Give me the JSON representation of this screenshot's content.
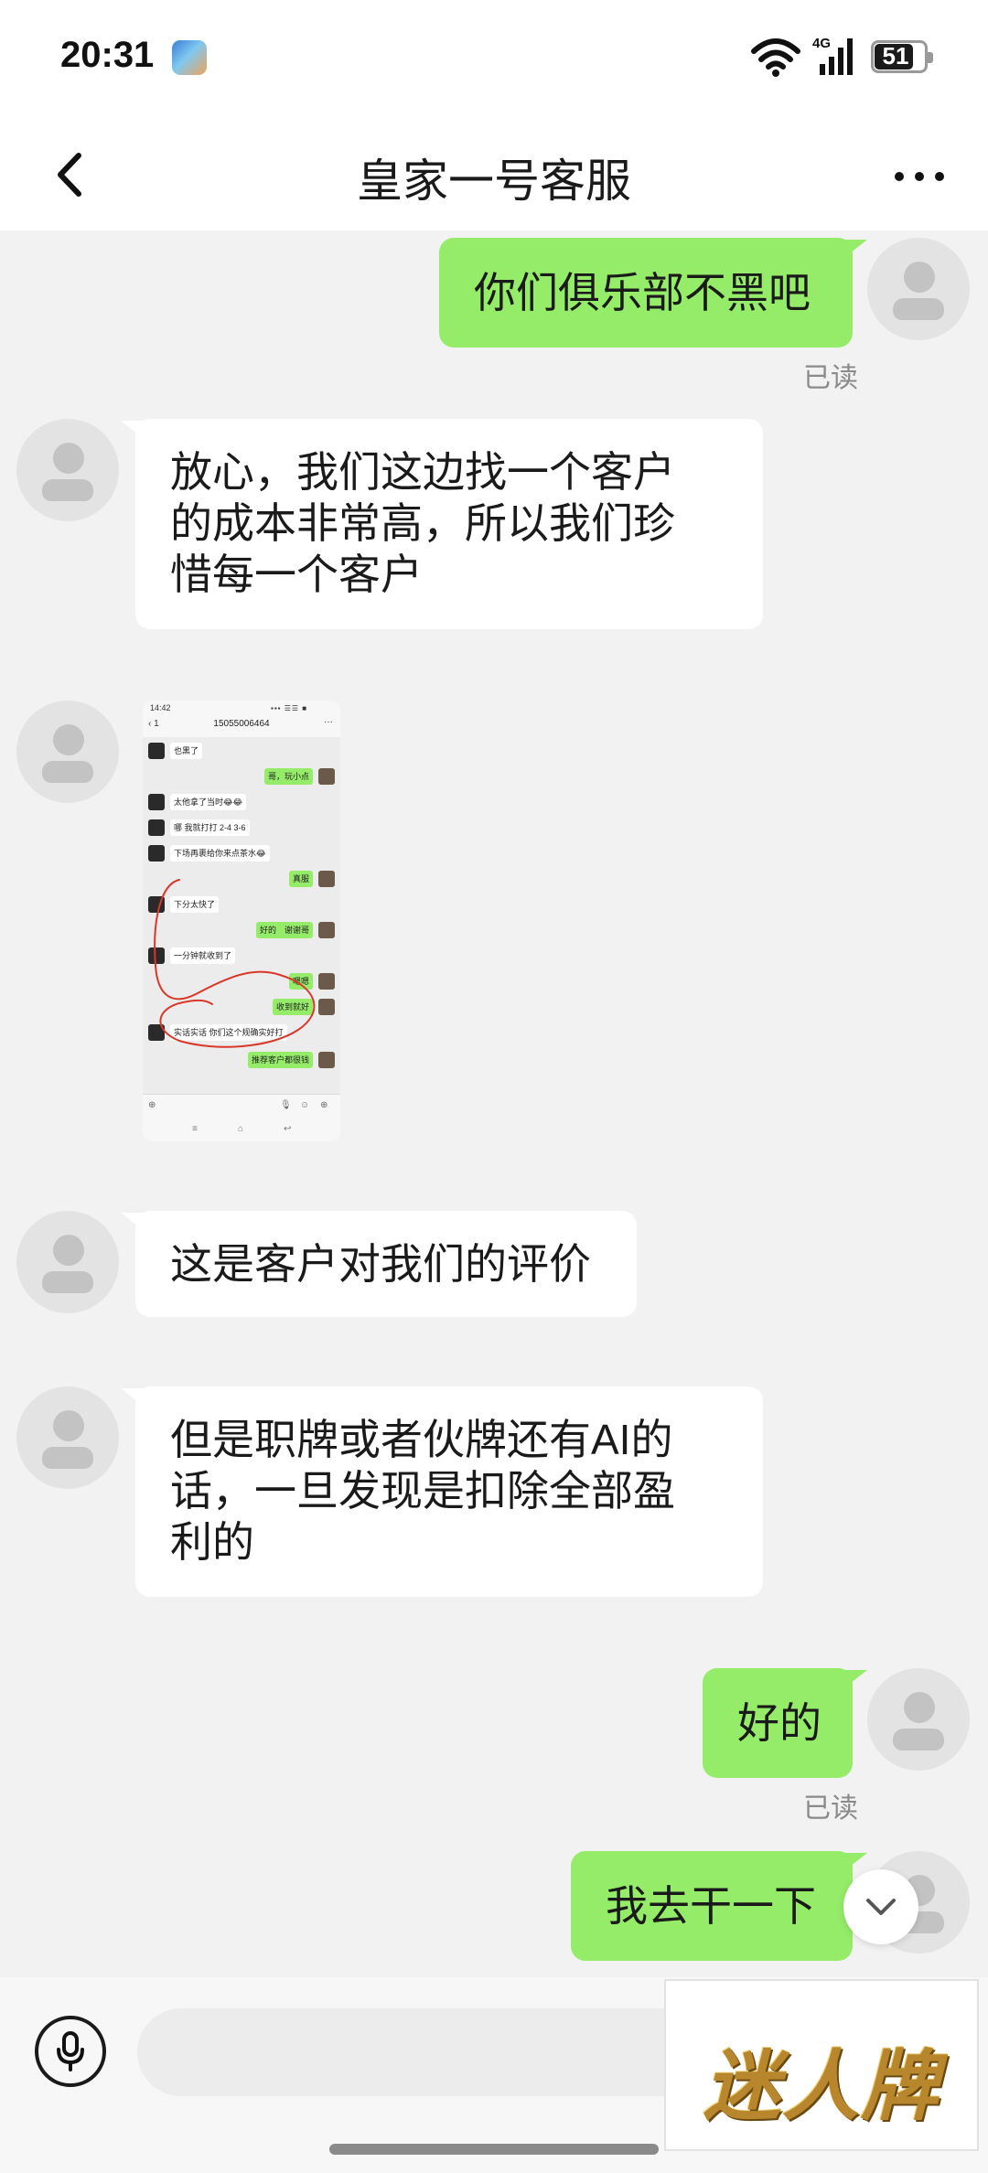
{
  "status_bar": {
    "time": "20:31",
    "battery": "51"
  },
  "header": {
    "title": "皇家一号客服"
  },
  "messages": {
    "m1": {
      "text": "你们俱乐部不黑吧",
      "read": "已读"
    },
    "m2": {
      "lines": [
        "放心，我们这边找一个客户",
        "的成本非常高，所以我们珍",
        "惜每一个客户"
      ]
    },
    "m4": {
      "text": "这是客户对我们的评价"
    },
    "m5": {
      "lines": [
        "但是职牌或者伙牌还有AI的",
        "话，一旦发现是扣除全部盈",
        "利的"
      ]
    },
    "m6": {
      "text": "好的",
      "read": "已读"
    },
    "m7": {
      "text": "我去干一下"
    }
  },
  "screenshot": {
    "time": "14:42",
    "status_icons": "▪▪▪ ☰☰ ■",
    "back": "‹ 1",
    "title": "15055006464",
    "more": "···",
    "rows": [
      "也黑了",
      "哥，玩小点",
      "太他拿了当时😂😂",
      "哪 我就打打 2-4 3-6",
      "下场再裹给你来点茶水😂",
      "真服",
      "下分太快了",
      "好的　谢谢哥",
      "一分钟就收到了",
      "嗯嗯",
      "收到就好",
      "实话实话 你们这个规确实好打",
      "推荐客户都很钱"
    ],
    "input_icons": [
      "⊕",
      "🎙",
      "☺",
      "⊕"
    ],
    "nav_icons": [
      "≡",
      "⌂",
      "↩"
    ]
  },
  "input": {
    "placeholder": ""
  },
  "watermark": {
    "text": "迷人牌"
  },
  "colors": {
    "sent_bubble": "#95ec69",
    "received_bubble": "#ffffff",
    "chat_background": "#f2f2f2",
    "header_background": "#ffffff",
    "read_text": "#8a8a8a",
    "watermark_gold": "#b8862d"
  },
  "icons": {
    "back": "chevron-left-icon",
    "more": "more-dots-icon",
    "voice": "microphone-icon",
    "scroll_down": "chevron-down-icon",
    "avatar": "default-avatar-icon"
  }
}
